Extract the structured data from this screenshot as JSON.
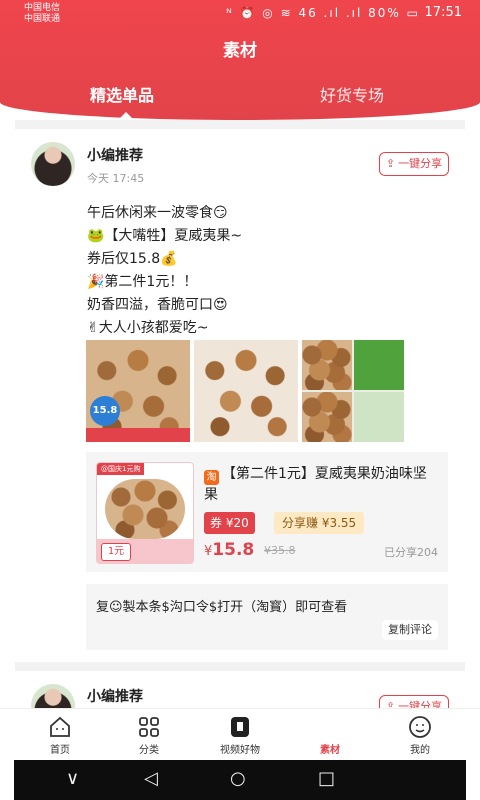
{
  "status_bar": {
    "carrier1": "中国电信",
    "carrier2": "中国联通",
    "icons": "ᴺ ⏰ ◎ ≋ 46 .ıl .ıl",
    "battery": "80%",
    "time": "17:51"
  },
  "header": {
    "title": "素材",
    "tabs": [
      {
        "label": "精选单品",
        "active": true
      },
      {
        "label": "好货专场",
        "active": false
      }
    ]
  },
  "post": {
    "author": "小编推荐",
    "time": "今天 17:45",
    "share_label": "一键分享",
    "lines": [
      "午后休闲来一波零食😏",
      "🐸【大嘴牲】夏威夷果~",
      "券后仅15.8💰",
      "🎉第二件1元！！",
      "奶香四溢，香脆可口😍",
      "✌大人小孩都爱吃~"
    ],
    "image_badge": "15.8",
    "product": {
      "image_tag": "@国庆1元购",
      "image_one": "1元",
      "platform": "淘",
      "name": "【第二件1元】夏威夷果奶油味坚果",
      "coupon": "券 ¥20",
      "earn": "分享赚 ¥3.55",
      "currency": "¥",
      "price": "15.8",
      "original_price": "¥35.8",
      "shared": "已分享204"
    },
    "copy_text": "复☺製本条$沟口令$打开（淘寳）即可查看",
    "copy_button": "复制评论"
  },
  "next_post": {
    "author": "小编推荐",
    "share_label": "一键分享"
  },
  "nav": [
    {
      "label": "首页",
      "icon": "home-icon",
      "active": false
    },
    {
      "label": "分类",
      "icon": "category-icon",
      "active": false
    },
    {
      "label": "视频好物",
      "icon": "video-icon",
      "active": false
    },
    {
      "label": "素材",
      "icon": "material-icon",
      "active": true
    },
    {
      "label": "我的",
      "icon": "profile-icon",
      "active": false
    }
  ],
  "system_nav": {
    "back": "◁",
    "home": "○",
    "recent": "□",
    "collapse": "∨"
  },
  "colors": {
    "accent": "#e2434a",
    "earn_bg": "#fde9c4",
    "page_bg": "#ffffff"
  }
}
